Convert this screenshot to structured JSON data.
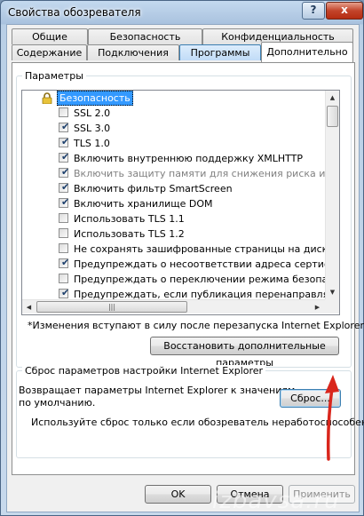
{
  "window": {
    "title": "Свойства обозревателя",
    "help_label": "?",
    "close_label": "x"
  },
  "tabs": [
    {
      "label": "Общие"
    },
    {
      "label": "Безопасность"
    },
    {
      "label": "Конфиденциальность"
    },
    {
      "label": "Содержание"
    },
    {
      "label": "Подключения"
    },
    {
      "label": "Программы"
    },
    {
      "label": "Дополнительно",
      "selected": true
    }
  ],
  "params": {
    "group_label": "Параметры",
    "category": "Безопасность",
    "items": [
      {
        "label": "SSL 2.0",
        "checked": false,
        "enabled": true
      },
      {
        "label": "SSL 3.0",
        "checked": true,
        "enabled": true
      },
      {
        "label": "TLS 1.0",
        "checked": true,
        "enabled": true
      },
      {
        "label": "Включить внутреннюю поддержку XMLHTTP",
        "checked": true,
        "enabled": true
      },
      {
        "label": "Включить защиту памяти для снижения риска интерне",
        "checked": true,
        "enabled": false
      },
      {
        "label": "Включить фильтр SmartScreen",
        "checked": true,
        "enabled": true
      },
      {
        "label": "Включить хранилище DOM",
        "checked": true,
        "enabled": true
      },
      {
        "label": "Использовать TLS 1.1",
        "checked": false,
        "enabled": true
      },
      {
        "label": "Использовать TLS 1.2",
        "checked": false,
        "enabled": true
      },
      {
        "label": "Не сохранять зашифрованные страницы на диск",
        "checked": false,
        "enabled": true
      },
      {
        "label": "Предупреждать о несоответствии адреса сертификат",
        "checked": true,
        "enabled": true
      },
      {
        "label": "Предупреждать о переключении режима безопасност",
        "checked": false,
        "enabled": true
      },
      {
        "label": "Предупреждать, если публикация перенаправляется",
        "checked": true,
        "enabled": true
      }
    ],
    "restart_note": "*Изменения вступают в силу после перезапуска Internet Explorer",
    "restore_button": "Восстановить дополнительные параметры"
  },
  "reset": {
    "group_label": "Сброс параметров настройки Internet Explorer",
    "description_line1": "Возвращает параметры Internet Explorer к значениям",
    "description_line2": "по умолчанию.",
    "reset_button": "Сброс...",
    "hint": "Используйте сброс только если обозреватель неработоспособен."
  },
  "footer": {
    "ok": "OK",
    "cancel": "Отмена",
    "apply": "Применить"
  },
  "watermark": "izbavsa.ru",
  "colors": {
    "annotation_arrow": "#d9261c",
    "selection": "#3399ff"
  }
}
